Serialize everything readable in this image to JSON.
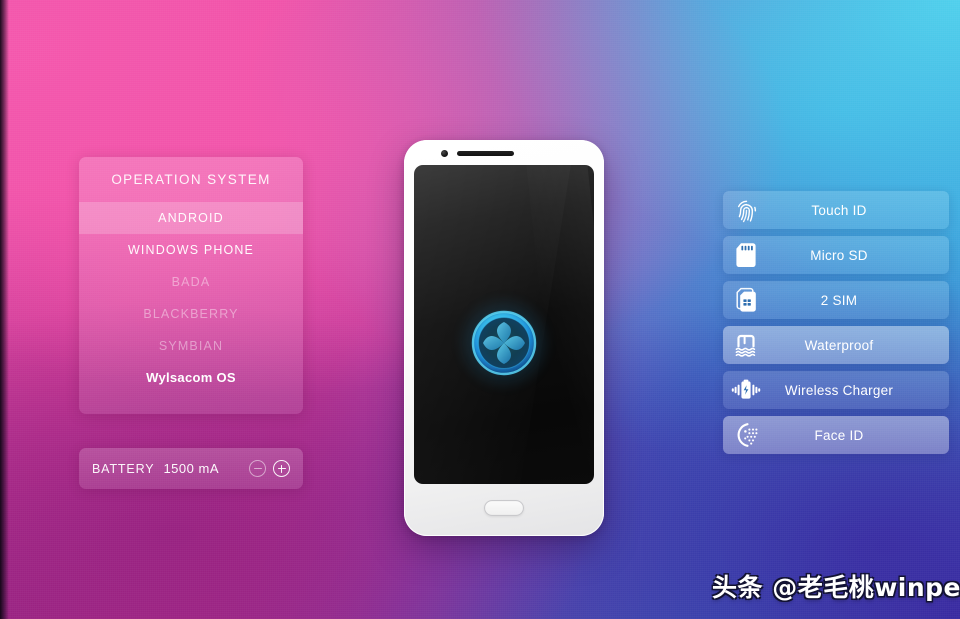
{
  "background": {
    "gradient_colors": [
      "#ec47a3",
      "#b43396",
      "#6f47b8",
      "#4169c4",
      "#44c6e8",
      "#9c2484",
      "#3b2ba0"
    ],
    "description": "pink to blue diagonal mesh gradient"
  },
  "os_panel": {
    "title": "OPERATION SYSTEM",
    "items": [
      {
        "label": "ANDROID",
        "state": "selected"
      },
      {
        "label": "WINDOWS PHONE",
        "state": "enabled"
      },
      {
        "label": "BADA",
        "state": "disabled"
      },
      {
        "label": "BLACKBERRY",
        "state": "disabled"
      },
      {
        "label": "SYMBIAN",
        "state": "disabled"
      },
      {
        "label": "Wylsacom OS",
        "state": "brand"
      }
    ]
  },
  "battery": {
    "label": "BATTERY",
    "value": "1500 mA",
    "decrement_icon": "minus-circle-icon",
    "increment_icon": "plus-circle-icon"
  },
  "features": [
    {
      "label": "Touch ID",
      "icon": "fingerprint-icon",
      "state": "inactive"
    },
    {
      "label": "Micro SD",
      "icon": "sd-card-icon",
      "state": "inactive"
    },
    {
      "label": "2 SIM",
      "icon": "sim-card-icon",
      "state": "inactive"
    },
    {
      "label": "Waterproof",
      "icon": "waterproof-icon",
      "state": "active"
    },
    {
      "label": "Wireless Charger",
      "icon": "wireless-charger-icon",
      "state": "inactive"
    },
    {
      "label": "Face ID",
      "icon": "face-id-icon",
      "state": "active"
    }
  ],
  "phone": {
    "camera_icon": "front-camera-icon",
    "speaker_icon": "earpiece-speaker-icon",
    "home_button_icon": "home-button-icon",
    "screen_logo_icon": "glowing-x-orb-logo-icon",
    "screen_logo_colors": [
      "#49d6f2",
      "#1e7fd0",
      "#0a2a52"
    ]
  },
  "watermark": {
    "text": "头条 @老毛桃winpe"
  }
}
